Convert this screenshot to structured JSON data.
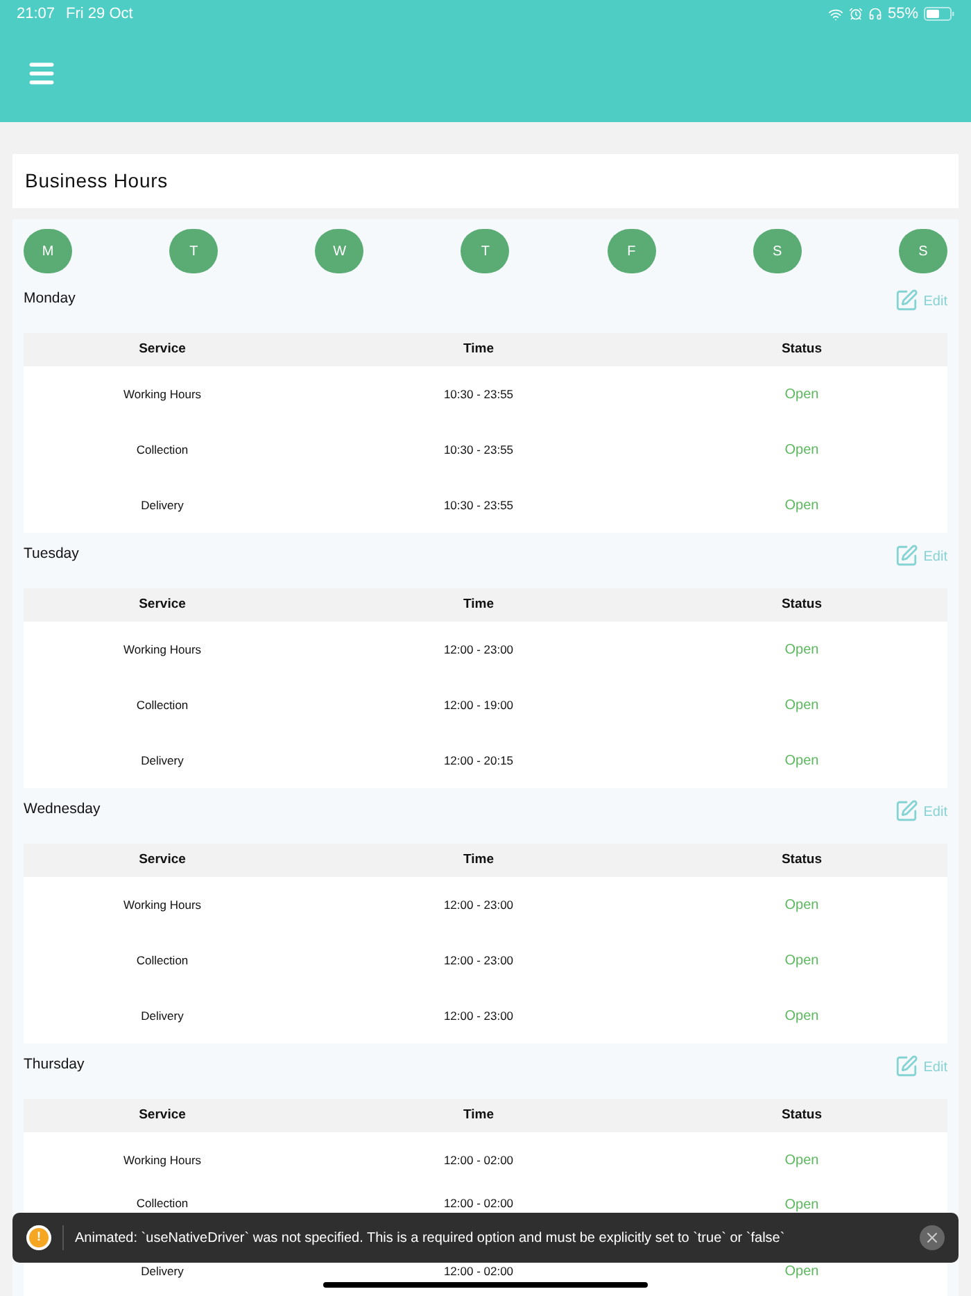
{
  "status_bar": {
    "time": "21:07",
    "date": "Fri 29 Oct",
    "battery": "55%"
  },
  "title": "Business Hours",
  "day_buttons": [
    "M",
    "T",
    "W",
    "T",
    "F",
    "S",
    "S"
  ],
  "days": [
    {
      "name": "Monday",
      "edit": "Edit",
      "columns": [
        "Service",
        "Time",
        "Status"
      ],
      "rows": [
        {
          "service": "Working Hours",
          "time": "10:30 - 23:55",
          "status": "Open"
        },
        {
          "service": "Collection",
          "time": "10:30 - 23:55",
          "status": "Open"
        },
        {
          "service": "Delivery",
          "time": "10:30 - 23:55",
          "status": "Open"
        }
      ]
    },
    {
      "name": "Tuesday",
      "edit": "Edit",
      "columns": [
        "Service",
        "Time",
        "Status"
      ],
      "rows": [
        {
          "service": "Working Hours",
          "time": "12:00 - 23:00",
          "status": "Open"
        },
        {
          "service": "Collection",
          "time": "12:00 - 19:00",
          "status": "Open"
        },
        {
          "service": "Delivery",
          "time": "12:00 - 20:15",
          "status": "Open"
        }
      ]
    },
    {
      "name": "Wednesday",
      "edit": "Edit",
      "columns": [
        "Service",
        "Time",
        "Status"
      ],
      "rows": [
        {
          "service": "Working Hours",
          "time": "12:00 - 23:00",
          "status": "Open"
        },
        {
          "service": "Collection",
          "time": "12:00 - 23:00",
          "status": "Open"
        },
        {
          "service": "Delivery",
          "time": "12:00 - 23:00",
          "status": "Open"
        }
      ]
    },
    {
      "name": "Thursday",
      "edit": "Edit",
      "columns": [
        "Service",
        "Time",
        "Status"
      ],
      "rows": [
        {
          "service": "Working Hours",
          "time": "12:00 - 02:00",
          "status": "Open"
        },
        {
          "service": "Collection",
          "time": "12:00 - 02:00",
          "status": "Open",
          "kind": "covered"
        },
        {
          "service": "Delivery",
          "time": "12:00 - 02:00",
          "status": "Open"
        }
      ]
    }
  ],
  "toast": {
    "icon": "!",
    "message": "Animated: `useNativeDriver` was not specified. This is a required option and must be explicitly set to `true` or `false`"
  }
}
